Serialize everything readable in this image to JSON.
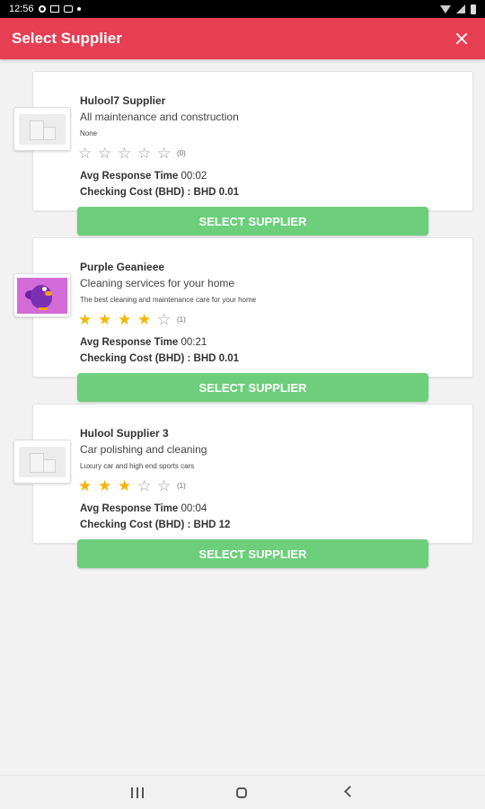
{
  "status_bar": {
    "time": "12:56",
    "left_icons": [
      "gear-icon",
      "image-icon",
      "cast-icon",
      "dot-icon"
    ],
    "right_icons": [
      "wifi-icon",
      "signal-icon",
      "battery-icon"
    ]
  },
  "app_bar": {
    "title": "Select Supplier",
    "close_icon": "close-icon",
    "color": "#e63e53"
  },
  "suppliers": [
    {
      "name": "Hulool7 Supplier",
      "category": "All maintenance and construction",
      "description": "None",
      "rating": 0,
      "rating_max": 5,
      "rating_count": "(0)",
      "response_label": "Avg Response Time",
      "response_value": "00:02",
      "cost_label": "Checking Cost (BHD) :",
      "cost_value": "BHD 0.01",
      "button_label": "SELECT SUPPLIER",
      "image": "building-placeholder-icon"
    },
    {
      "name": "Purple Geanieee",
      "category": "Cleaning services for your home",
      "description": "The best cleaning and maintenance care for your home",
      "rating": 4,
      "rating_max": 5,
      "rating_count": "(1)",
      "response_label": "Avg Response Time",
      "response_value": "00:21",
      "cost_label": "Checking Cost (BHD) :",
      "cost_value": "BHD 0.01",
      "button_label": "SELECT SUPPLIER",
      "image": "purple-bird-logo"
    },
    {
      "name": "Hulool Supplier 3",
      "category": "Car polishing and cleaning",
      "description": "Luxury car and high end sports cars",
      "rating": 3,
      "rating_max": 5,
      "rating_count": "(1)",
      "response_label": "Avg Response Time",
      "response_value": "00:04",
      "cost_label": "Checking Cost (BHD) :",
      "cost_value": "BHD 12",
      "button_label": "SELECT SUPPLIER",
      "image": "building-placeholder-icon"
    }
  ],
  "colors": {
    "button": "#6dce7b",
    "star_filled": "#f5b400",
    "star_empty": "#9a9a9a"
  },
  "nav_bar": {
    "icons": [
      "recent-apps-icon",
      "home-icon",
      "back-icon"
    ]
  }
}
